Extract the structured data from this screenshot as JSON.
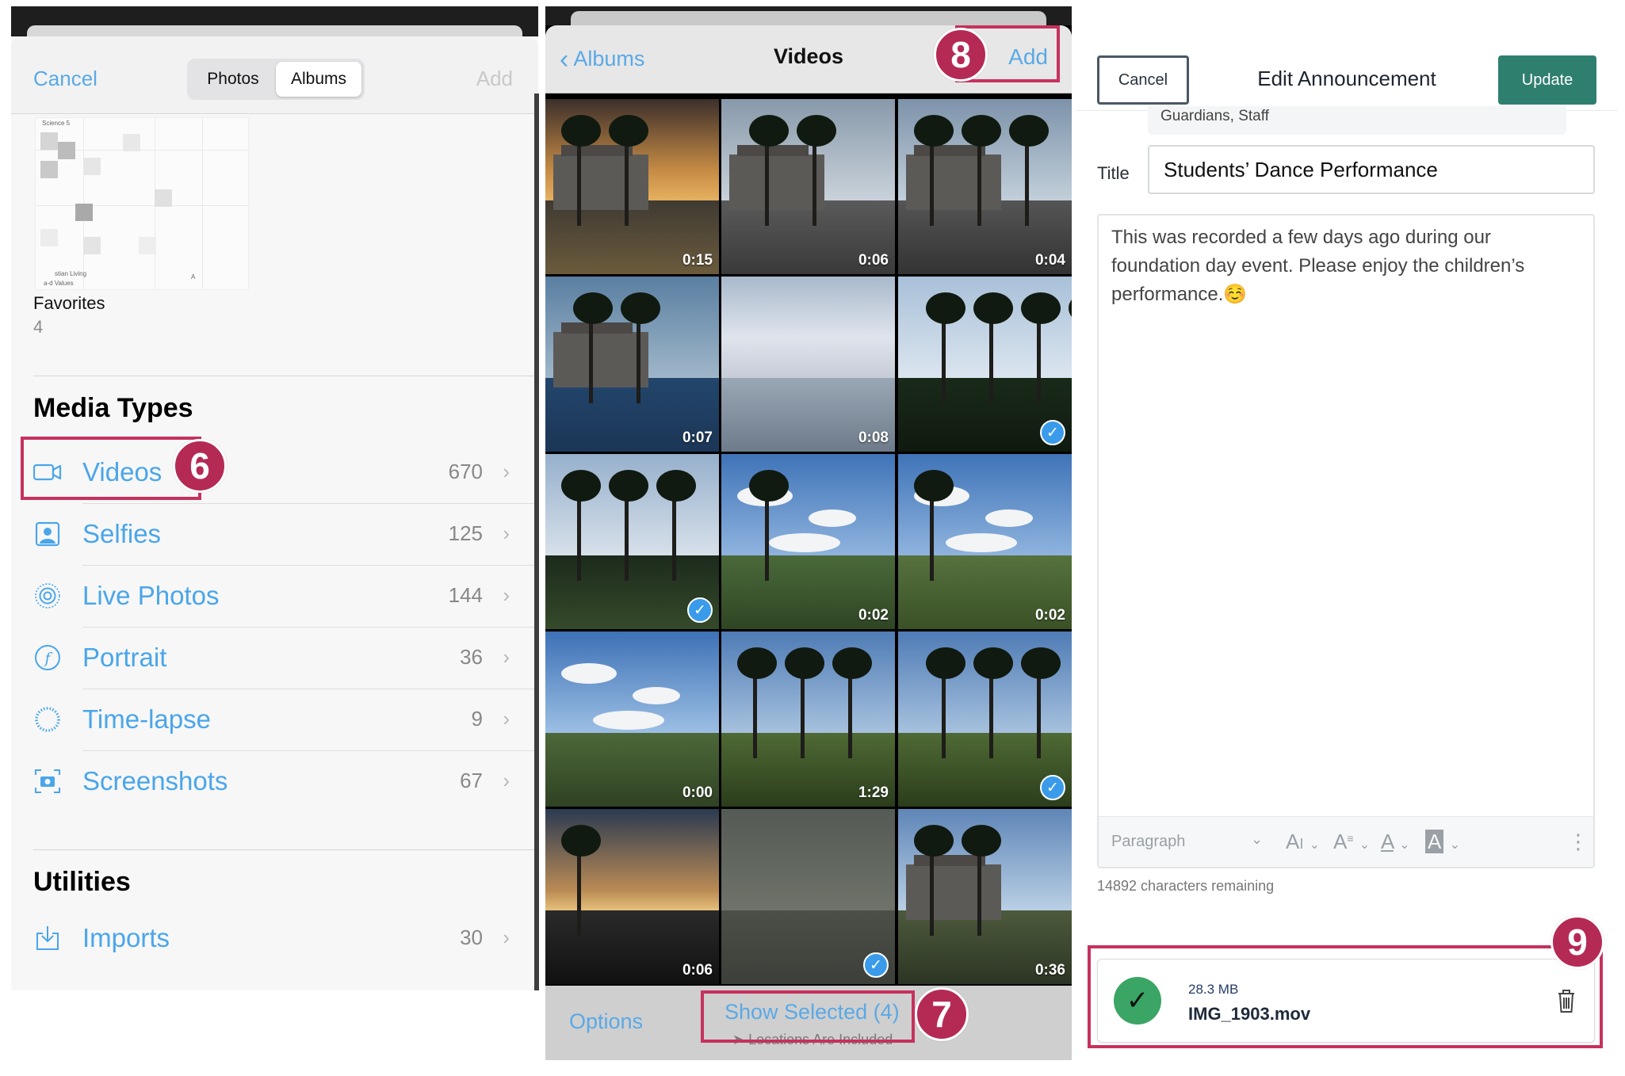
{
  "panel1": {
    "cancel": "Cancel",
    "add": "Add",
    "segments": [
      "Photos",
      "Albums"
    ],
    "thumb_small_text": [
      "Science 5",
      "stian Living",
      "a-d Values",
      "A"
    ],
    "favorites_label": "Favorites",
    "favorites_count": "4",
    "media_types_header": "Media Types",
    "media_rows": [
      {
        "label": "Videos",
        "count": "670",
        "icon": "video-camera-icon"
      },
      {
        "label": "Selfies",
        "count": "125",
        "icon": "selfie-portrait-icon"
      },
      {
        "label": "Live Photos",
        "count": "144",
        "icon": "live-photo-icon"
      },
      {
        "label": "Portrait",
        "count": "36",
        "icon": "portrait-f-icon"
      },
      {
        "label": "Time-lapse",
        "count": "9",
        "icon": "timelapse-icon"
      },
      {
        "label": "Screenshots",
        "count": "67",
        "icon": "screenshot-camera-icon"
      }
    ],
    "utilities_header": "Utilities",
    "utility_rows": [
      {
        "label": "Imports",
        "count": "30",
        "icon": "import-tray-icon"
      }
    ],
    "chevron": "›",
    "step_badge": "6"
  },
  "panel2": {
    "back": "Albums",
    "title": "Videos",
    "add": "Add",
    "step_badge_add": "8",
    "tiles": [
      {
        "duration": "0:15",
        "checked": false
      },
      {
        "duration": "0:06",
        "checked": false
      },
      {
        "duration": "0:04",
        "checked": false
      },
      {
        "duration": "0:07",
        "checked": false
      },
      {
        "duration": "0:08",
        "checked": false
      },
      {
        "duration": "",
        "checked": true
      },
      {
        "duration": "",
        "checked": true
      },
      {
        "duration": "0:02",
        "checked": false
      },
      {
        "duration": "0:02",
        "checked": false
      },
      {
        "duration": "0:00",
        "checked": false
      },
      {
        "duration": "1:29",
        "checked": false
      },
      {
        "duration": "",
        "checked": true
      },
      {
        "duration": "0:06",
        "checked": false
      },
      {
        "duration": "",
        "checked": true
      },
      {
        "duration": "0:36",
        "checked": false
      }
    ],
    "options": "Options",
    "show_selected": "Show Selected (4)",
    "locations_note": "Locations Are Included",
    "step_badge_show": "7"
  },
  "panel3": {
    "cancel": "Cancel",
    "title": "Edit Announcement",
    "update": "Update",
    "audience": "Guardians, Staff",
    "title_label": "Title",
    "title_value": "Students’ Dance Performance",
    "body_text": "This was recorded a few days ago during our foundation day event. Please enjoy the children’s performance.☺️",
    "paragraph_style": "Paragraph",
    "chars_remaining": "14892 characters remaining",
    "file_size": "28.3 MB",
    "file_name": "IMG_1903.mov",
    "step_badge": "9"
  },
  "colors": {
    "ios_blue": "#4aa6ea",
    "highlight": "#c6315d",
    "badge": "#b52a55",
    "update_green": "#2f7f6f",
    "success_green": "#3aa564"
  }
}
